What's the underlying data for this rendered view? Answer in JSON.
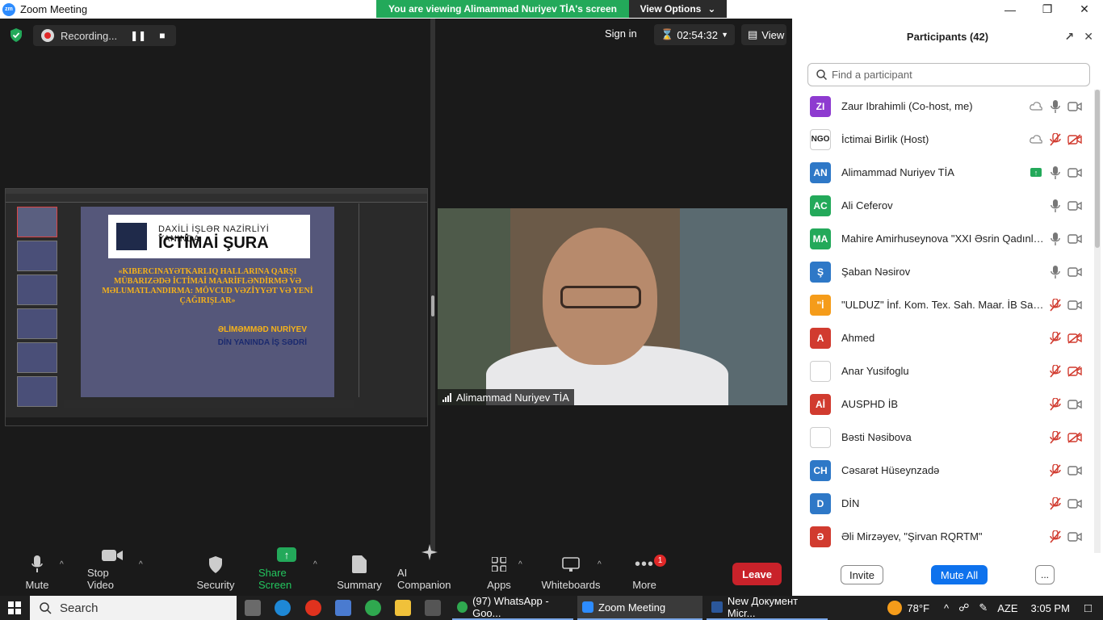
{
  "window": {
    "title": "Zoom Meeting",
    "logo_text": "zm"
  },
  "banner": {
    "text": "You are viewing Alimammad Nuriyev TİA's screen",
    "view_options": "View Options"
  },
  "topbar": {
    "recording_label": "Recording...",
    "sign_in": "Sign in",
    "timer": "02:54:32",
    "view_label": "View"
  },
  "shared_slide": {
    "header_line1": "DAXİLİ İŞLƏR NAZİRLİYİ YANINDA",
    "header_line2": "İCTİMAİ ŞURA",
    "title": "«KIBERCINAYƏTKARLIQ HALLARINA QARŞI MÜBARIZƏDƏ İCTİMAİ MAARİFLƏNDİRMƏ VƏ MƏLUMATLANDIRMA: MÖVCUD VƏZİYYƏT VƏ YENİ ÇAĞIRIŞLAR»",
    "author": "ƏLİMƏMMƏD NURİYEV",
    "position": "DİN YANINDA İŞ SƏDRİ"
  },
  "video": {
    "speaker_name": "Alimammad Nuriyev TİA"
  },
  "toolbar": {
    "mute": "Mute",
    "stop_video": "Stop Video",
    "security": "Security",
    "share_screen": "Share Screen",
    "summary": "Summary",
    "ai_companion": "AI Companion",
    "apps": "Apps",
    "whiteboards": "Whiteboards",
    "more": "More",
    "more_badge": "1",
    "leave": "Leave"
  },
  "participants_panel": {
    "title": "Participants (42)",
    "search_placeholder": "Find a participant",
    "invite": "Invite",
    "mute_all": "Mute All",
    "more": "...",
    "participants": [
      {
        "initials": "ZI",
        "color": "#8e3bd0",
        "name": "Zaur Ibrahimli (Co-host, me)",
        "mic": "on",
        "video": "off",
        "extra": "cloud-icon"
      },
      {
        "initials": "NGO",
        "color": "#ffffff",
        "name": "İctimai Birlik (Host)",
        "mic": "muted",
        "video": "muted",
        "extra": "cloud-icon"
      },
      {
        "initials": "AN",
        "color": "#2e78c7",
        "name": "Alimammad Nuriyev TİA",
        "mic": "on",
        "video": "off",
        "extra": "share-icon"
      },
      {
        "initials": "AC",
        "color": "#23a95a",
        "name": "Ali Ceferov",
        "mic": "on",
        "video": "off",
        "extra": ""
      },
      {
        "initials": "MA",
        "color": "#23a95a",
        "name": "Mahire Amirhuseynova \"XXI Əsrin Qadınla...",
        "mic": "on",
        "video": "off",
        "extra": ""
      },
      {
        "initials": "Ş",
        "color": "#2e78c7",
        "name": "Şaban Nəsirov",
        "mic": "on",
        "video": "off",
        "extra": ""
      },
      {
        "initials": "\"İ",
        "color": "#f59c1a",
        "name": "\"ULDUZ\" İnf. Kom. Tex. Sah. Maar. İB Sami...",
        "mic": "muted",
        "video": "off",
        "extra": ""
      },
      {
        "initials": "A",
        "color": "#d13b2f",
        "name": "Ahmed",
        "mic": "muted",
        "video": "muted",
        "extra": ""
      },
      {
        "initials": "",
        "color": "#ffffff",
        "name": "Anar Yusifoglu",
        "mic": "muted",
        "video": "muted",
        "extra": ""
      },
      {
        "initials": "Aİ",
        "color": "#d13b2f",
        "name": "AUSPHD İB",
        "mic": "muted",
        "video": "off",
        "extra": ""
      },
      {
        "initials": "",
        "color": "#ffffff",
        "name": "Bəsti Nəsibova",
        "mic": "muted",
        "video": "muted",
        "extra": ""
      },
      {
        "initials": "CH",
        "color": "#2e78c7",
        "name": "Cəsarət Hüseynzadə",
        "mic": "muted",
        "video": "off",
        "extra": ""
      },
      {
        "initials": "D",
        "color": "#2e78c7",
        "name": "DİN",
        "mic": "muted",
        "video": "off",
        "extra": ""
      },
      {
        "initials": "Ə",
        "color": "#d13b2f",
        "name": "Əli Mirzəyev, \"Şirvan RQRTM\"",
        "mic": "muted",
        "video": "off",
        "extra": ""
      }
    ]
  },
  "taskbar": {
    "search": "Search",
    "tasks": [
      {
        "label": "(97) WhatsApp - Goo..."
      },
      {
        "label": "Zoom Meeting"
      },
      {
        "label": "New Документ Micr..."
      }
    ],
    "weather": "78°F",
    "language": "AZE",
    "time": "3:05 PM"
  }
}
